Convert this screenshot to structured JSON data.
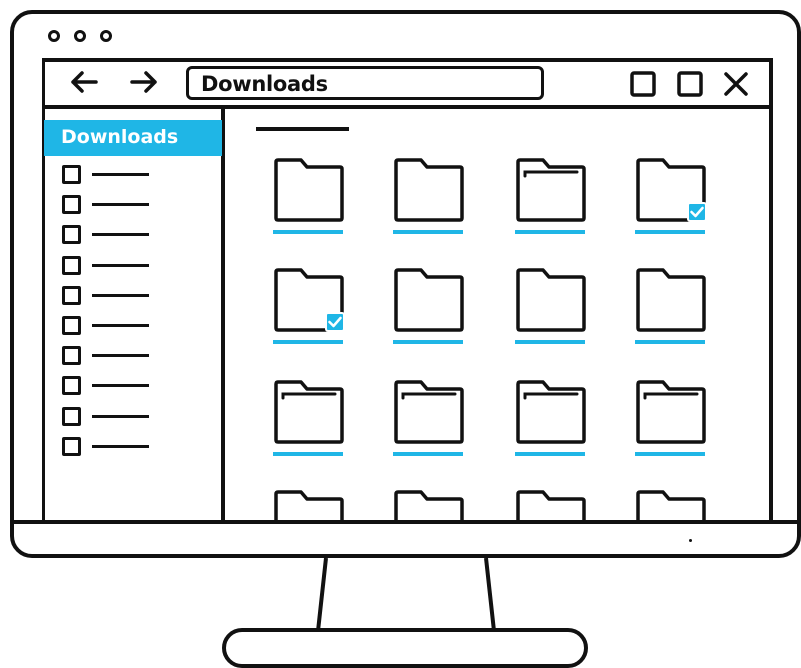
{
  "browser": {
    "address": "Downloads",
    "window_dots": [
      "dot",
      "dot",
      "dot"
    ],
    "icons": {
      "back": "arrow-left-icon",
      "forward": "arrow-right-icon",
      "minimize": "square-icon",
      "maximize": "square-icon",
      "close": "close-icon"
    }
  },
  "sidebar": {
    "header": "Downloads",
    "items": [
      {
        "checked": false
      },
      {
        "checked": false
      },
      {
        "checked": false
      },
      {
        "checked": false
      },
      {
        "checked": false
      },
      {
        "checked": false
      },
      {
        "checked": false
      },
      {
        "checked": false
      },
      {
        "checked": false
      },
      {
        "checked": false
      }
    ]
  },
  "main": {
    "folders": [
      {
        "icon": "folder-icon",
        "selected": false
      },
      {
        "icon": "folder-icon",
        "selected": false
      },
      {
        "icon": "folder-open-icon",
        "selected": false
      },
      {
        "icon": "folder-icon",
        "selected": true
      },
      {
        "icon": "folder-icon",
        "selected": true
      },
      {
        "icon": "folder-icon",
        "selected": false
      },
      {
        "icon": "folder-icon",
        "selected": false
      },
      {
        "icon": "folder-icon",
        "selected": false
      },
      {
        "icon": "folder-open-icon",
        "selected": false
      },
      {
        "icon": "folder-open-icon",
        "selected": false
      },
      {
        "icon": "folder-open-icon",
        "selected": false
      },
      {
        "icon": "folder-open-icon",
        "selected": false
      },
      {
        "icon": "folder-icon",
        "selected": false
      },
      {
        "icon": "folder-icon",
        "selected": false
      },
      {
        "icon": "folder-icon",
        "selected": false
      },
      {
        "icon": "folder-icon",
        "selected": false
      }
    ]
  },
  "colors": {
    "accent": "#1fb6e6",
    "outline": "#111111",
    "background": "#ffffff"
  }
}
